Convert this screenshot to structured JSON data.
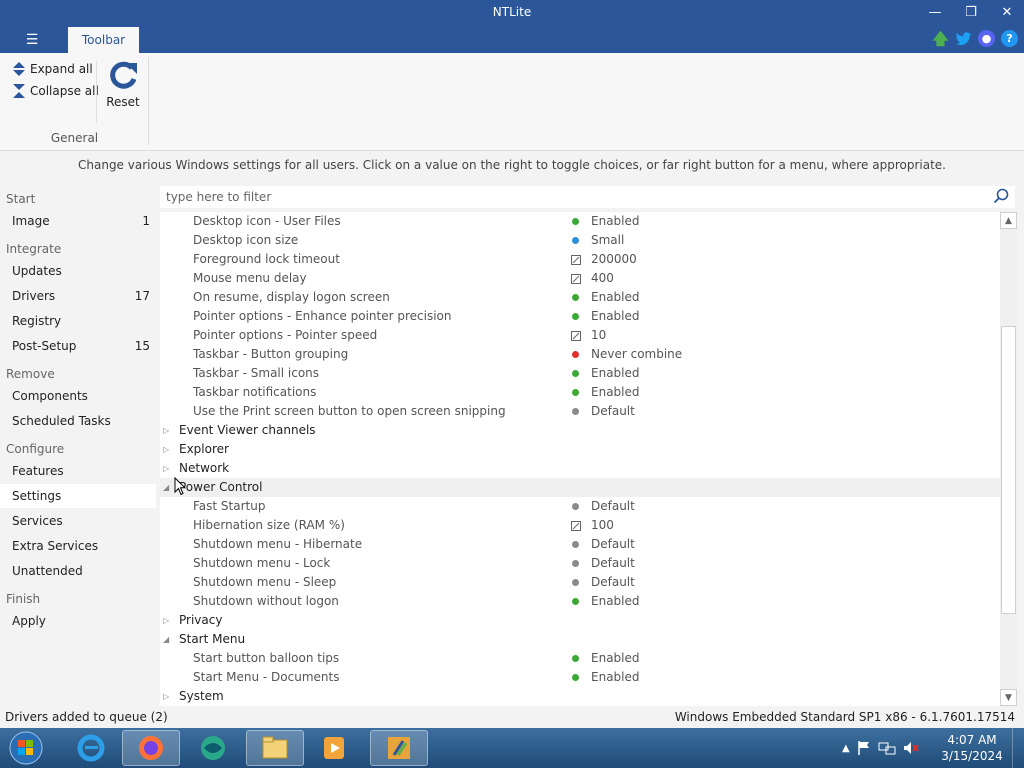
{
  "window": {
    "title": "NTLite"
  },
  "ribbon": {
    "tab": "Toolbar",
    "expand_all": "Expand all",
    "collapse_all": "Collapse all",
    "reset": "Reset",
    "group_label": "General"
  },
  "hint": "Change various Windows settings for all users. Click on a value on the right to toggle choices, or far right button for a menu, where appropriate.",
  "sidebar": {
    "sections": {
      "start": "Start",
      "integrate": "Integrate",
      "remove": "Remove",
      "configure": "Configure",
      "finish": "Finish"
    },
    "items": {
      "image": {
        "label": "Image",
        "count": "1"
      },
      "updates": {
        "label": "Updates"
      },
      "drivers": {
        "label": "Drivers",
        "count": "17"
      },
      "registry": {
        "label": "Registry"
      },
      "post_setup": {
        "label": "Post-Setup",
        "count": "15"
      },
      "components": {
        "label": "Components"
      },
      "scheduled_tasks": {
        "label": "Scheduled Tasks"
      },
      "features": {
        "label": "Features"
      },
      "settings": {
        "label": "Settings"
      },
      "services": {
        "label": "Services"
      },
      "extra_services": {
        "label": "Extra Services"
      },
      "unattended": {
        "label": "Unattended"
      },
      "apply": {
        "label": "Apply"
      }
    }
  },
  "filter": {
    "placeholder": "type here to filter"
  },
  "tree": {
    "rows": [
      {
        "name": "Desktop icon - User Files",
        "value": "Enabled"
      },
      {
        "name": "Desktop icon size",
        "value": "Small"
      },
      {
        "name": "Foreground lock timeout",
        "value": "200000"
      },
      {
        "name": "Mouse menu delay",
        "value": "400"
      },
      {
        "name": "On resume, display logon screen",
        "value": "Enabled"
      },
      {
        "name": "Pointer options - Enhance pointer precision",
        "value": "Enabled"
      },
      {
        "name": "Pointer options - Pointer speed",
        "value": "10"
      },
      {
        "name": "Taskbar - Button grouping",
        "value": "Never combine"
      },
      {
        "name": "Taskbar - Small icons",
        "value": "Enabled"
      },
      {
        "name": "Taskbar notifications",
        "value": "Enabled"
      },
      {
        "name": "Use the Print screen button to open screen snipping",
        "value": "Default"
      },
      {
        "name": "Event Viewer channels"
      },
      {
        "name": "Explorer"
      },
      {
        "name": "Network"
      },
      {
        "name": "Power Control"
      },
      {
        "name": "Fast Startup",
        "value": "Default"
      },
      {
        "name": "Hibernation size (RAM %)",
        "value": "100"
      },
      {
        "name": "Shutdown menu - Hibernate",
        "value": "Default"
      },
      {
        "name": "Shutdown menu - Lock",
        "value": "Default"
      },
      {
        "name": "Shutdown menu - Sleep",
        "value": "Default"
      },
      {
        "name": "Shutdown without logon",
        "value": "Enabled"
      },
      {
        "name": "Privacy"
      },
      {
        "name": "Start Menu"
      },
      {
        "name": "Start button balloon tips",
        "value": "Enabled"
      },
      {
        "name": "Start Menu - Documents",
        "value": "Enabled"
      },
      {
        "name": "System"
      }
    ]
  },
  "status": {
    "left": "Drivers added to queue (2)",
    "right": "Windows Embedded Standard SP1 x86 - 6.1.7601.17514"
  },
  "taskbar": {
    "time": "4:07 AM",
    "date": "3/15/2024"
  },
  "colors": {
    "titlebar": "#2b579a",
    "enabled_dot": "#3aaa35",
    "small_dot": "#2e8fd6",
    "never_combine_dot": "#e0302a",
    "default_dot": "#8a8a8a"
  }
}
